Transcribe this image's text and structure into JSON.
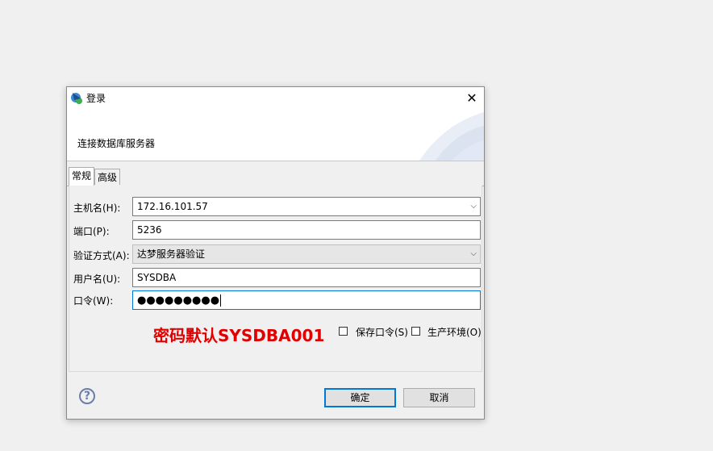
{
  "window": {
    "title": "登录",
    "close_glyph": "✕",
    "app_icon": "dm-app-icon"
  },
  "banner": {
    "subtitle": "连接数据库服务器"
  },
  "tabs": [
    {
      "label": "常规",
      "active": true
    },
    {
      "label": "高级",
      "active": false
    }
  ],
  "form": {
    "host": {
      "label": "主机名(H):",
      "value": "172.16.101.57"
    },
    "port": {
      "label": "端口(P):",
      "value": "5236"
    },
    "auth": {
      "label": "验证方式(A):",
      "value": "达梦服务器验证"
    },
    "user": {
      "label": "用户名(U):",
      "value": "SYSDBA"
    },
    "password": {
      "label": "口令(W):",
      "masked": "●●●●●●●●●"
    }
  },
  "annotation": "密码默认SYSDBA001",
  "options": {
    "save_password": {
      "label": "保存口令(S)",
      "checked": false
    },
    "production_env": {
      "label": "生产环境(O)",
      "checked": false
    }
  },
  "footer": {
    "help_glyph": "?",
    "ok_label": "确定",
    "cancel_label": "取消"
  },
  "colors": {
    "focus": "#0078d7",
    "annotation": "#e00000"
  }
}
